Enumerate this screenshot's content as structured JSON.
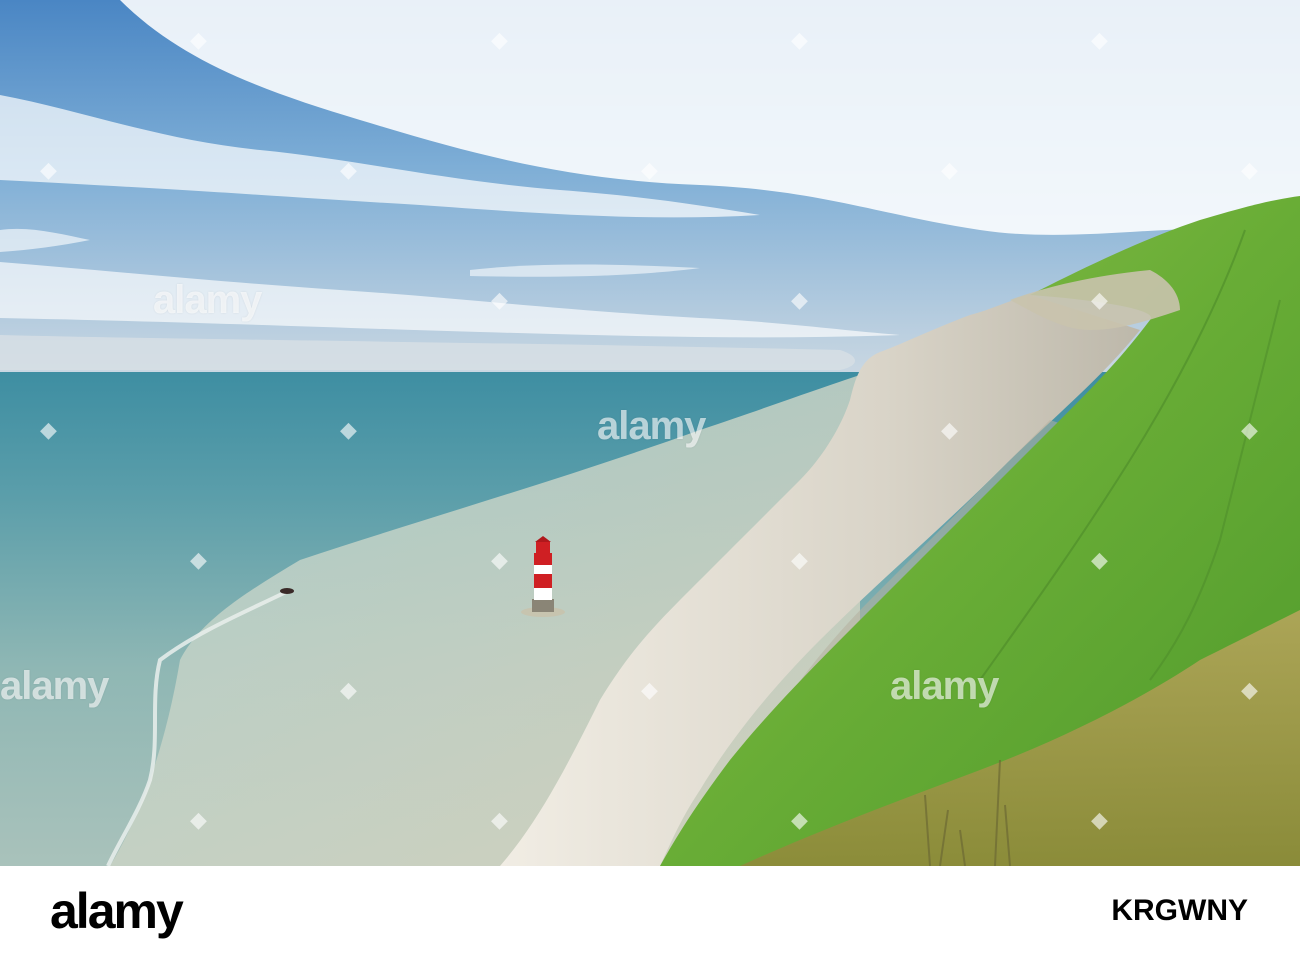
{
  "watermark": {
    "text": "alamy"
  },
  "footer": {
    "brand": "alamy",
    "image_id": "KRGWNY"
  },
  "colors": {
    "sky_top": "#4f89c4",
    "sea": "#6aa3a8",
    "grass": "#6fae34",
    "chalk": "#e2ddd2",
    "lighthouse_red": "#cf1f23"
  },
  "icons": [
    "alamy-diamond-mark"
  ]
}
